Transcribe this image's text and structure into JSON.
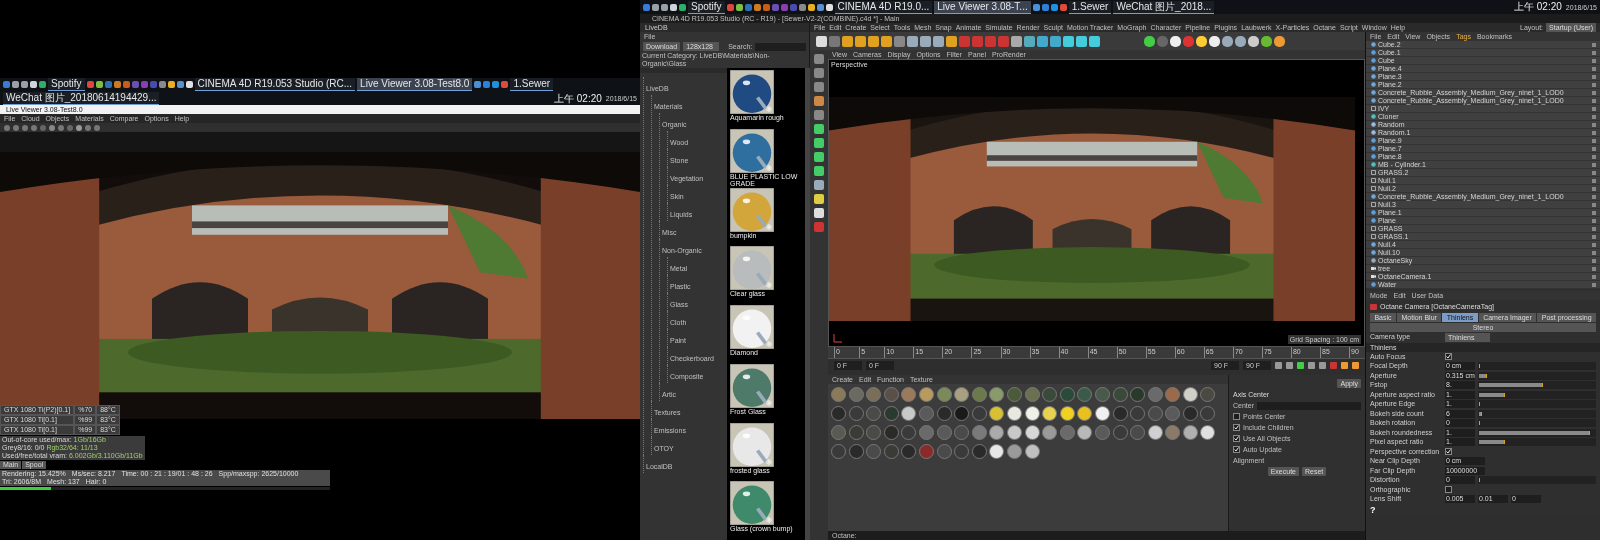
{
  "left_monitor": {
    "taskbar": {
      "items": [
        {
          "kind": "icon",
          "color": "#3a7bd5"
        },
        {
          "kind": "icon",
          "color": "#9aa0a8"
        },
        {
          "kind": "icon",
          "color": "#9aa0a8"
        },
        {
          "kind": "icon",
          "color": "#d0d4da"
        },
        {
          "kind": "icon",
          "color": "#2fae6a"
        },
        {
          "kind": "app",
          "label": "Spotify",
          "selected": false
        },
        {
          "kind": "icon",
          "color": "#e0473c"
        },
        {
          "kind": "icon",
          "color": "#7bc043"
        },
        {
          "kind": "icon",
          "color": "#2e6fb5"
        },
        {
          "kind": "icon",
          "color": "#d07a1f"
        },
        {
          "kind": "icon",
          "color": "#c85d1a"
        },
        {
          "kind": "icon",
          "color": "#6a4fb5"
        },
        {
          "kind": "icon",
          "color": "#8a3fb0"
        },
        {
          "kind": "icon",
          "color": "#4a4ab0"
        },
        {
          "kind": "icon",
          "color": "#8a8a8a"
        },
        {
          "kind": "icon",
          "color": "#e8b020"
        },
        {
          "kind": "icon",
          "color": "#5a8fd0"
        },
        {
          "kind": "icon",
          "color": "#e0e0e0"
        },
        {
          "kind": "app",
          "label": "CINEMA 4D R19.053 Studio (RC...",
          "selected": false
        },
        {
          "kind": "app",
          "label": "Live Viewer 3.08-Test8.0",
          "selected": true
        },
        {
          "kind": "icon",
          "color": "#4a90d9"
        },
        {
          "kind": "icon",
          "color": "#2d7fd8"
        },
        {
          "kind": "icon",
          "color": "#1e90e0"
        },
        {
          "kind": "icon",
          "color": "#e04a3a"
        },
        {
          "kind": "app",
          "label": "1.Sewer",
          "selected": false
        },
        {
          "kind": "app",
          "label": "WeChat 图片_20180614194429...",
          "selected": false
        }
      ],
      "clock": {
        "time": "上午 02:20",
        "date": "2018/6/15"
      }
    },
    "window": {
      "title": "Live Viewer 3.08-Test8.0",
      "menu": [
        "File",
        "Cloud",
        "Objects",
        "Materials",
        "Compare",
        "Options",
        "Help"
      ],
      "render": {
        "kind": "picture"
      },
      "gpus": [
        {
          "name": "GTX 1080 Ti(P2)[0.1]",
          "load": "%70",
          "temp": "88°C"
        },
        {
          "name": "GTX 1080 Ti[0.1]",
          "load": "%99",
          "temp": "83°C"
        },
        {
          "name": "GTX 1080 Ti[0.1]",
          "load": "%99",
          "temp": "83°C"
        }
      ],
      "memory": [
        {
          "label": "Out-of-core used/max:",
          "value": "1Gb/16Gb"
        },
        {
          "label": "Grey8/16: 0/0",
          "value": "Rgb32/64: 11/13"
        },
        {
          "label": "Used/free/total vram:",
          "value": "6.002Gb/3.110Gb/11Gb"
        }
      ],
      "buttons": [
        "Main",
        "Spool"
      ],
      "status": {
        "level": 0.154,
        "fields": [
          "Rendering: 15.425%",
          "Ms/sec: 8.217",
          "Time: 00 : 21 : 19/01 : 48 : 26",
          "Spp/maxspp: 2625/10000",
          "Tri: 2606/8M",
          "Mesh: 137",
          "Hair: 0"
        ]
      }
    }
  },
  "right_monitor": {
    "taskbar": {
      "items": [
        {
          "kind": "icon",
          "color": "#3a7bd5"
        },
        {
          "kind": "icon",
          "color": "#9aa0a8"
        },
        {
          "kind": "icon",
          "color": "#9aa0a8"
        },
        {
          "kind": "icon",
          "color": "#d0d4da"
        },
        {
          "kind": "icon",
          "color": "#2fae6a"
        },
        {
          "kind": "app",
          "label": "Spotify",
          "selected": false
        },
        {
          "kind": "icon",
          "color": "#e0473c"
        },
        {
          "kind": "icon",
          "color": "#7bc043"
        },
        {
          "kind": "icon",
          "color": "#2e6fb5"
        },
        {
          "kind": "icon",
          "color": "#d07a1f"
        },
        {
          "kind": "icon",
          "color": "#c85d1a"
        },
        {
          "kind": "icon",
          "color": "#6a4fb5"
        },
        {
          "kind": "icon",
          "color": "#8a3fb0"
        },
        {
          "kind": "icon",
          "color": "#4a4ab0"
        },
        {
          "kind": "icon",
          "color": "#8a8a8a"
        },
        {
          "kind": "icon",
          "color": "#e8b020"
        },
        {
          "kind": "icon",
          "color": "#5a8fd0"
        },
        {
          "kind": "icon",
          "color": "#e0e0e0"
        },
        {
          "kind": "app",
          "label": "CINEMA 4D R19.0...",
          "selected": false
        },
        {
          "kind": "app",
          "label": "Live Viewer 3.08-T...",
          "selected": true
        },
        {
          "kind": "icon",
          "color": "#4a90d9"
        },
        {
          "kind": "icon",
          "color": "#2d7fd8"
        },
        {
          "kind": "icon",
          "color": "#1e90e0"
        },
        {
          "kind": "icon",
          "color": "#e04a3a"
        },
        {
          "kind": "app",
          "label": "1.Sewer",
          "selected": false
        },
        {
          "kind": "app",
          "label": "WeChat 图片_2018...",
          "selected": false
        }
      ],
      "clock": {
        "time": "上午 02:20",
        "date": "2018/6/15"
      }
    },
    "window_title": "CINEMA 4D R19.053 Studio (RC - R19) - [Sewer-V2-2(COMBINE).c4d *] - Main",
    "livedb": {
      "title": "LiveDB",
      "menu": [
        "File"
      ],
      "download": "Download",
      "size": "128x128",
      "search_label": "Search:",
      "category": "Current Category: LiveDB\\Materials\\Non-Organic\\Glass",
      "tree": [
        {
          "label": "LiveDB",
          "children": [
            {
              "label": "Materials",
              "children": [
                {
                  "label": "Organic",
                  "children": [
                    {
                      "label": "Wood"
                    },
                    {
                      "label": "Stone"
                    },
                    {
                      "label": "Vegetation"
                    },
                    {
                      "label": "Skin"
                    },
                    {
                      "label": "Liquids"
                    }
                  ]
                },
                {
                  "label": "Misc"
                },
                {
                  "label": "Non-Organic",
                  "children": [
                    {
                      "label": "Metal"
                    },
                    {
                      "label": "Plastic"
                    },
                    {
                      "label": "Glass"
                    },
                    {
                      "label": "Cloth"
                    },
                    {
                      "label": "Paint"
                    },
                    {
                      "label": "Checkerboard"
                    },
                    {
                      "label": "Composite"
                    }
                  ]
                },
                {
                  "label": "Artic"
                }
              ]
            },
            {
              "label": "Textures"
            },
            {
              "label": "Emissions"
            },
            {
              "label": "OTOY"
            }
          ]
        },
        {
          "label": "LocalDB"
        }
      ],
      "materials": [
        {
          "name": "Aquamarin rough",
          "color": "#1f4a82"
        },
        {
          "name": "BLUE PLASTIC LOW GRADE",
          "color": "#2f6fa0"
        },
        {
          "name": "bumpkin",
          "color": "#d2a63a"
        },
        {
          "name": "Clear glass",
          "color": "#b8bcbc"
        },
        {
          "name": "Diamond",
          "color": "#f2f2f2"
        },
        {
          "name": "Frost Glass",
          "color": "#4e7a6a"
        },
        {
          "name": "frosted glass",
          "color": "#e8e8e8"
        },
        {
          "name": "Glass (crown bump)",
          "color": "#3f8a6a"
        }
      ]
    },
    "menu": [
      "File",
      "Edit",
      "Create",
      "Select",
      "Tools",
      "Mesh",
      "Snap",
      "Animate",
      "Simulate",
      "Render",
      "Sculpt",
      "Motion Tracker",
      "MoGraph",
      "Character",
      "Pipeline",
      "Plugins",
      "Laubwerk",
      "X-Particles",
      "Octane",
      "Script",
      "Window",
      "Help"
    ],
    "layout": {
      "label": "Layout:",
      "value": "Startup (User)"
    },
    "viewport": {
      "menu": [
        "View",
        "Cameras",
        "Display",
        "Options",
        "Filter",
        "Panel",
        "ProRender"
      ],
      "camera": "Perspective",
      "scene": {
        "kind": "picture"
      },
      "grid": "Grid Spacing : 100 cm"
    },
    "timeline": {
      "ticks": [
        "0",
        "5",
        "10",
        "15",
        "20",
        "25",
        "30",
        "35",
        "40",
        "45",
        "50",
        "55",
        "60",
        "65",
        "70",
        "75",
        "80",
        "85",
        "90"
      ],
      "fields": [
        "0 F",
        "0 F",
        "90 F",
        "90 F"
      ]
    },
    "material_manager": {
      "menu": [
        "Create",
        "Edit",
        "Function",
        "Texture"
      ],
      "rows": [
        {
          "swatches": [
            {
              "color": "#8a7a5a"
            },
            {
              "color": "#6a6a62"
            },
            {
              "color": "#7a6e58"
            },
            {
              "color": "#5a5048"
            },
            {
              "color": "#9a7a5a"
            },
            {
              "color": "#b89a60"
            },
            {
              "color": "#7a8a5a"
            },
            {
              "color": "#a8a080"
            },
            {
              "color": "#6a7a48"
            },
            {
              "color": "#8a9a6a"
            },
            {
              "color": "#4a5a3a"
            },
            {
              "color": "#6a7050"
            },
            {
              "color": "#3a4a3a"
            },
            {
              "color": "#2a4a3a"
            },
            {
              "color": "#3a5a4a"
            },
            {
              "color": "#4a5a4a"
            },
            {
              "color": "#3a4a38"
            },
            {
              "color": "#2a3a2a"
            },
            {
              "color": "#6a6a6a"
            },
            {
              "color": "#9a6a4a"
            },
            {
              "color": "#d0d0c8"
            },
            {
              "color": "#4a4a42"
            }
          ]
        },
        {
          "swatches": [
            {
              "color": "#2a2a2a"
            },
            {
              "color": "#3a3a3a"
            },
            {
              "color": "#4a4a48"
            },
            {
              "color": "#2a3a2e"
            },
            {
              "color": "#c8c8c8"
            },
            {
              "color": "#5a5a5a"
            },
            {
              "color": "#2a2a2a"
            },
            {
              "color": "#1a1a1a"
            },
            {
              "color": "#3a3a3a"
            },
            {
              "color": "#d8c030"
            },
            {
              "color": "#e8e8e0"
            },
            {
              "color": "#f0f0e8"
            },
            {
              "color": "#e8d050"
            },
            {
              "color": "#f0d020"
            },
            {
              "color": "#e8c020"
            },
            {
              "color": "#f0f0f0"
            },
            {
              "color": "#2a2a2a"
            },
            {
              "color": "#3a3a3a"
            },
            {
              "color": "#4a4a4a"
            },
            {
              "color": "#5a5a5a"
            },
            {
              "color": "#2a2a2a"
            },
            {
              "color": "#3a3a3a"
            }
          ]
        },
        {
          "swatches": [
            {
              "color": "#5a5a52"
            },
            {
              "color": "#3a3a36"
            },
            {
              "color": "#4a4a46"
            },
            {
              "color": "#2a2a28"
            },
            {
              "color": "#3a3a3a"
            },
            {
              "color": "#6a6a6a"
            },
            {
              "color": "#5a5a5a"
            },
            {
              "color": "#4a4a4a"
            },
            {
              "color": "#7a7a7a"
            },
            {
              "color": "#aaaaaa"
            },
            {
              "color": "#c8c8c8"
            },
            {
              "color": "#d8d8d8"
            },
            {
              "color": "#9a9a9a"
            },
            {
              "color": "#6a6a6a"
            },
            {
              "color": "#b8b8b8"
            },
            {
              "color": "#5a5a5a"
            },
            {
              "color": "#3a3a3a"
            },
            {
              "color": "#4a4a4a"
            },
            {
              "color": "#d0d0d0"
            },
            {
              "color": "#8a7a6a"
            },
            {
              "color": "#b0b0b0"
            },
            {
              "color": "#e0e0e0"
            }
          ]
        },
        {
          "swatches": [
            {
              "color": "#3a3a3a"
            },
            {
              "color": "#2a2a2a"
            },
            {
              "color": "#4a4a4a"
            },
            {
              "color": "#3a3a36"
            },
            {
              "color": "#2a2a2a"
            },
            {
              "color": "#8a2a2a"
            },
            {
              "color": "#4a4a4a"
            },
            {
              "color": "#3a3a3a"
            },
            {
              "color": "#2a2a2a"
            },
            {
              "color": "#e8e8e8"
            },
            {
              "color": "#9a9a9a"
            },
            {
              "color": "#c0c0c0"
            }
          ]
        }
      ]
    },
    "coordinates": {
      "apply": "Apply",
      "section": "Axis Center",
      "center_label": "Center",
      "options": [
        {
          "label": "Points Center",
          "checked": false
        },
        {
          "label": "Include Children",
          "checked": true
        },
        {
          "label": "Use All Objects",
          "checked": true
        },
        {
          "label": "Auto Update",
          "checked": true
        }
      ],
      "alignment": "Alignment",
      "buttons": [
        "Execute",
        "Reset"
      ]
    },
    "status_bar": "Octane:",
    "object_manager": {
      "menu": [
        {
          "label": "File",
          "selected": false
        },
        {
          "label": "Edit",
          "selected": false
        },
        {
          "label": "View",
          "selected": false
        },
        {
          "label": "Objects",
          "selected": false
        },
        {
          "label": "Tags",
          "selected": true
        },
        {
          "label": "Bookmarks",
          "selected": false
        }
      ],
      "objects": [
        {
          "name": "Cube.2",
          "kind": "poly"
        },
        {
          "name": "Cube.1",
          "kind": "cube"
        },
        {
          "name": "Cube",
          "kind": "cube"
        },
        {
          "name": "Plane.4",
          "kind": "poly"
        },
        {
          "name": "Plane.3",
          "kind": "poly"
        },
        {
          "name": "Plane.2",
          "kind": "poly"
        },
        {
          "name": "Concrete_Rubble_Assembly_Medium_Grey_ninet_1_LOD0",
          "kind": "poly"
        },
        {
          "name": "Concrete_Rubble_Assembly_Medium_Grey_ninet_1_LOD0",
          "kind": "poly"
        },
        {
          "name": "IVY",
          "kind": "null"
        },
        {
          "name": "Cloner",
          "kind": "cloner"
        },
        {
          "name": "Random",
          "kind": "effector"
        },
        {
          "name": "Random.1",
          "kind": "effector"
        },
        {
          "name": "Plane.9",
          "kind": "plane"
        },
        {
          "name": "Plane.7",
          "kind": "plane"
        },
        {
          "name": "Plane.8",
          "kind": "plane"
        },
        {
          "name": "MB - Cylinder.1",
          "kind": "cloner"
        },
        {
          "name": "GRASS.2",
          "kind": "null"
        },
        {
          "name": "Null.1",
          "kind": "null"
        },
        {
          "name": "Null.2",
          "kind": "null"
        },
        {
          "name": "Concrete_Rubble_Assembly_Medium_Grey_ninet_1_LOD0",
          "kind": "poly"
        },
        {
          "name": "Null.3",
          "kind": "null"
        },
        {
          "name": "Plane.1",
          "kind": "plane"
        },
        {
          "name": "Plane",
          "kind": "plane"
        },
        {
          "name": "GRASS",
          "kind": "null"
        },
        {
          "name": "GRASS.1",
          "kind": "null"
        },
        {
          "name": "Null.4",
          "kind": "poly"
        },
        {
          "name": "Null.10",
          "kind": "poly"
        },
        {
          "name": "OctaneSky",
          "kind": "sky"
        },
        {
          "name": "tree",
          "kind": "camera"
        },
        {
          "name": "OctaneCamera.1",
          "kind": "camera"
        },
        {
          "name": "Water",
          "kind": "plane"
        }
      ]
    },
    "attributes": {
      "menu": [
        "Mode",
        "Edit",
        "User Data"
      ],
      "header": "Octane Camera [OctaneCameraTag]",
      "tabs": [
        {
          "label": "Basic",
          "selected": false
        },
        {
          "label": "Motion Blur",
          "selected": false
        },
        {
          "label": "Thinlens",
          "selected": true
        },
        {
          "label": "Camera Imager",
          "selected": false
        },
        {
          "label": "Post processing",
          "selected": false
        },
        {
          "label": "Stereo",
          "selected": false
        }
      ],
      "camera_type": {
        "label": "Camera type",
        "value": "Thinlens"
      },
      "section": "Thinlens",
      "params": [
        {
          "kind": "check",
          "label": "Auto Focus",
          "checked": true
        },
        {
          "kind": "slider",
          "label": "Focal Depth",
          "value": "0 cm",
          "level": 0
        },
        {
          "kind": "slider",
          "label": "Aperture",
          "value": "0.315 cm",
          "level": 0.07
        },
        {
          "kind": "slider",
          "label": "Fstop",
          "value": "8.",
          "level": 0.58
        },
        {
          "kind": "slider",
          "label": "Aperture aspect ratio",
          "value": "1.",
          "level": 0.23
        },
        {
          "kind": "slider",
          "label": "Aperture Edge",
          "value": "1.",
          "level": 0
        },
        {
          "kind": "slider",
          "label": "Bokeh side count",
          "value": "6",
          "level": 0.03
        },
        {
          "kind": "slider",
          "label": "Bokeh rotation",
          "value": "0",
          "level": 0
        },
        {
          "kind": "slider",
          "label": "Bokeh roundedness",
          "value": "1.",
          "level": 1
        },
        {
          "kind": "slider",
          "label": "Pixel aspect ratio",
          "value": "1.",
          "level": 0.23
        },
        {
          "kind": "check",
          "label": "Perspective correction",
          "checked": true
        },
        {
          "kind": "field",
          "label": "Near Clip Depth",
          "value": "0 cm"
        },
        {
          "kind": "field",
          "label": "Far Clip Depth",
          "value": "10000000"
        },
        {
          "kind": "slider",
          "label": "Distortion",
          "value": "0",
          "level": 0
        },
        {
          "kind": "check",
          "label": "Orthographic",
          "checked": false
        },
        {
          "kind": "triple",
          "label": "Lens Shift",
          "values": [
            "0.005",
            "0.01",
            "0"
          ]
        }
      ],
      "help": "?"
    }
  }
}
